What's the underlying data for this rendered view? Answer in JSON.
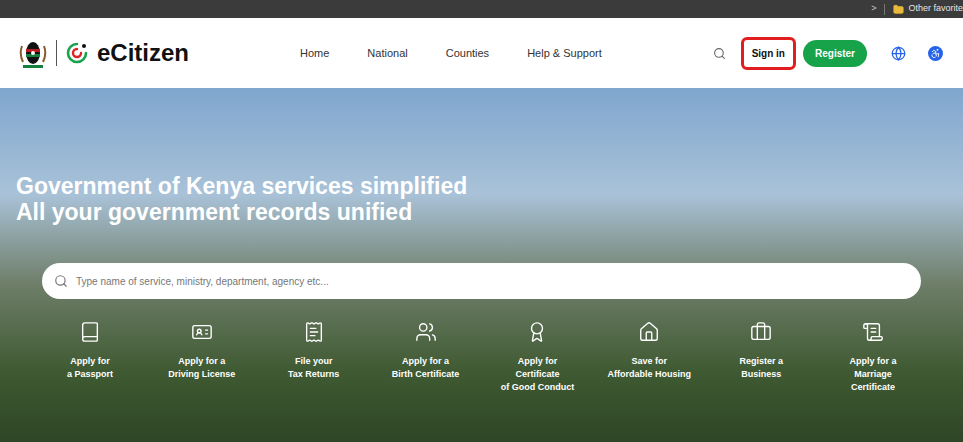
{
  "browser_bar": {
    "chevron": ">",
    "folder": "Other favorite"
  },
  "header": {
    "brand": "eCitizen",
    "nav": [
      {
        "label": "Home"
      },
      {
        "label": "National"
      },
      {
        "label": "Counties"
      },
      {
        "label": "Help & Support"
      }
    ],
    "actions": [
      {
        "label": "Sign in",
        "kind": "outline",
        "highlighted": true
      },
      {
        "label": "Register",
        "kind": "filled",
        "highlighted": false
      }
    ]
  },
  "hero": {
    "headline": [
      {
        "plain": "Government of Kenya services ",
        "bold": "simplified"
      },
      {
        "plain": "All your government records ",
        "bold": "unified"
      }
    ],
    "search": {
      "placeholder": "Type name of service, ministry, department, agency etc..."
    },
    "services": [
      {
        "lines": [
          "Apply for",
          "a Passport"
        ]
      },
      {
        "lines": [
          "Apply for a",
          "Driving License"
        ]
      },
      {
        "lines": [
          "File your",
          "Tax Returns"
        ]
      },
      {
        "lines": [
          "Apply for a",
          "Birth Certificate"
        ]
      },
      {
        "lines": [
          "Apply for",
          "Certificate",
          "of Good Conduct"
        ]
      },
      {
        "lines": [
          "Save for",
          "Affordable Housing"
        ]
      },
      {
        "lines": [
          "Register a",
          "Business"
        ]
      },
      {
        "lines": [
          "Apply for a",
          "Marriage",
          "Certificate"
        ]
      }
    ]
  }
}
